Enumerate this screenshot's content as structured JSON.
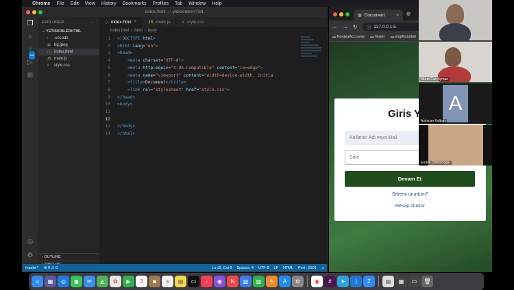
{
  "menubar": {
    "app": "Chrome",
    "items": [
      "File",
      "Edit",
      "View",
      "History",
      "Bookmarks",
      "Profiles",
      "Tab",
      "Window",
      "Help"
    ]
  },
  "vscode": {
    "title": "index.html — yetiskinlerHTML",
    "explorer_header": "EXPLORER",
    "folder": "YETISKINLERHTML",
    "files": [
      ".vscode",
      "bg.jpeg",
      "index.html",
      "main.js",
      "style.css"
    ],
    "outline": "OUTLINE",
    "timeline": "TIMELINE",
    "tabs": [
      "index.html",
      "main.js",
      "style.css"
    ],
    "breadcrumb": [
      "index.html",
      "html",
      "body"
    ],
    "badge": "10K",
    "code_lines": [
      {
        "n": "1",
        "parts": [
          [
            "doc",
            "<!DOCTYPE "
          ],
          [
            "attr",
            "html"
          ],
          [
            "doc",
            ">"
          ]
        ]
      },
      {
        "n": "2",
        "parts": [
          [
            "tag",
            "<html "
          ],
          [
            "attr",
            "lang"
          ],
          [
            "txt",
            "="
          ],
          [
            "str",
            "\"en\""
          ],
          [
            "tag",
            ">"
          ]
        ]
      },
      {
        "n": "3",
        "parts": [
          [
            "tag",
            "<head>"
          ]
        ]
      },
      {
        "n": "4",
        "parts": [
          [
            "txt",
            "    "
          ],
          [
            "tag",
            "<meta "
          ],
          [
            "attr",
            "charset"
          ],
          [
            "txt",
            "="
          ],
          [
            "str",
            "\"UTF-8\""
          ],
          [
            "tag",
            ">"
          ]
        ]
      },
      {
        "n": "5",
        "parts": [
          [
            "txt",
            "    "
          ],
          [
            "tag",
            "<meta "
          ],
          [
            "attr",
            "http-equiv"
          ],
          [
            "txt",
            "="
          ],
          [
            "str",
            "\"X-UA-Compatible\""
          ],
          [
            "txt",
            " "
          ],
          [
            "attr",
            "content"
          ],
          [
            "txt",
            "="
          ],
          [
            "str",
            "\"ie=edge\""
          ],
          [
            "tag",
            ">"
          ]
        ]
      },
      {
        "n": "6",
        "parts": [
          [
            "txt",
            "    "
          ],
          [
            "tag",
            "<meta "
          ],
          [
            "attr",
            "name"
          ],
          [
            "txt",
            "="
          ],
          [
            "str",
            "\"viewport\""
          ],
          [
            "txt",
            " "
          ],
          [
            "attr",
            "content"
          ],
          [
            "txt",
            "="
          ],
          [
            "str",
            "\"width=device-width, initia"
          ]
        ]
      },
      {
        "n": "7",
        "parts": [
          [
            "txt",
            "    "
          ],
          [
            "tag",
            "<title>"
          ],
          [
            "txt",
            "Document"
          ],
          [
            "tag",
            "</title>"
          ]
        ]
      },
      {
        "n": "8",
        "parts": [
          [
            "txt",
            "    "
          ],
          [
            "tag",
            "<link "
          ],
          [
            "attr",
            "rel"
          ],
          [
            "txt",
            "="
          ],
          [
            "str",
            "\"stylesheet\""
          ],
          [
            "txt",
            " "
          ],
          [
            "attr",
            "href"
          ],
          [
            "txt",
            "="
          ],
          [
            "str",
            "\"style.css\""
          ],
          [
            "tag",
            ">"
          ]
        ]
      },
      {
        "n": "9",
        "parts": [
          [
            "tag",
            "</head>"
          ]
        ]
      },
      {
        "n": "10",
        "parts": [
          [
            "tag",
            "<body>"
          ]
        ]
      },
      {
        "n": "11",
        "parts": []
      },
      {
        "n": "12",
        "parts": []
      },
      {
        "n": "13",
        "parts": [
          [
            "tag",
            "</body>"
          ]
        ]
      },
      {
        "n": "14",
        "parts": [
          [
            "tag",
            "</html>"
          ]
        ]
      }
    ],
    "status": {
      "branch": "master*",
      "problems": "⊗ 0  ⚠ 0",
      "position": "Ln 12, Col 8",
      "spaces": "Spaces: 4",
      "encoding": "UTF-8",
      "eol": "LF",
      "language": "HTML",
      "port": "Port : 5501"
    }
  },
  "chrome": {
    "tab_title": "Document",
    "url": "127.0.0.1:5",
    "bookmarks": [
      "NordeaAccounts",
      "Tester",
      "engiNurullah"
    ],
    "login": {
      "title": "Giris Y",
      "username_placeholder": "Kullanici Adi veya Mail",
      "password_placeholder": "Sifre",
      "submit_label": "Devam Et",
      "forgot_link": "Sifremi unuttum?",
      "register_link": "Hesap olustur"
    }
  },
  "zoom": {
    "participants": [
      "",
      "Murat Can Aymaz",
      "Asimcan Kalkan",
      "Erdem Demircioglu"
    ],
    "avatar_letter": "A"
  },
  "colors": {
    "accent": "#0e639c",
    "login_button": "#1f4d1c",
    "link": "#2a4fa0"
  }
}
